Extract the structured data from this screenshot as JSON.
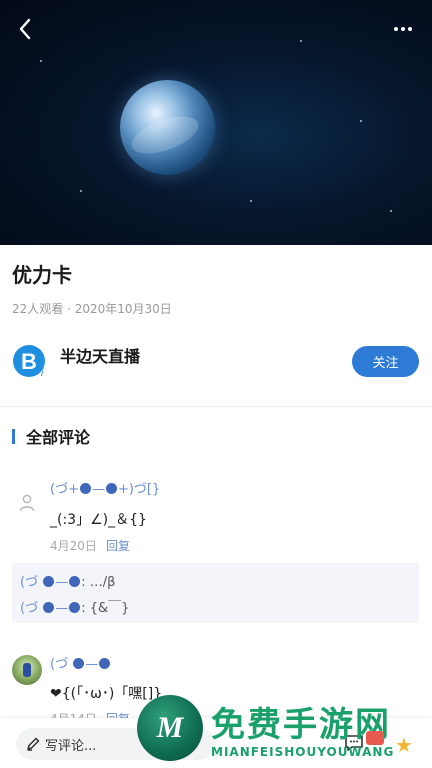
{
  "video": {
    "back_icon": "chevron-left-icon",
    "more_icon": "more-dots-icon"
  },
  "post": {
    "title": "优力卡",
    "meta": "22人观看 · 2020年10月30日"
  },
  "channel": {
    "name": "半边天直播",
    "follow_label": "关注",
    "logo_icon": "channel-logo-b",
    "accent_color": "#2e7bd6"
  },
  "comments_section": {
    "heading": "全部评论",
    "comments": [
      {
        "name_pre": "(づ+",
        "name_mid": "—",
        "name_post": "+)づ[}",
        "text": "_(:3」∠)_＆{}",
        "date": "4月20日",
        "reply_label": "回复",
        "replies": [
          {
            "name_pre": "(づ ",
            "name_mid": "—",
            "text": ": …/β"
          },
          {
            "name_pre": "(づ ",
            "name_mid": "—",
            "text": ": {&￣}"
          }
        ]
      },
      {
        "name_pre": "(づ ",
        "name_mid": "—",
        "text": "❤{(「･ω･)「嘿[]}",
        "date": "4月14日",
        "reply_label": "回复"
      }
    ]
  },
  "bottom_bar": {
    "input_placeholder": "写评论...",
    "pen_icon": "pen-icon",
    "comment_icon": "comment-bubble-icon"
  },
  "watermark": {
    "title": "免费手游网",
    "subtitle": "MIANFEISHOUYOUWANG",
    "logo_letter": "M",
    "color": "#1aa06a"
  }
}
